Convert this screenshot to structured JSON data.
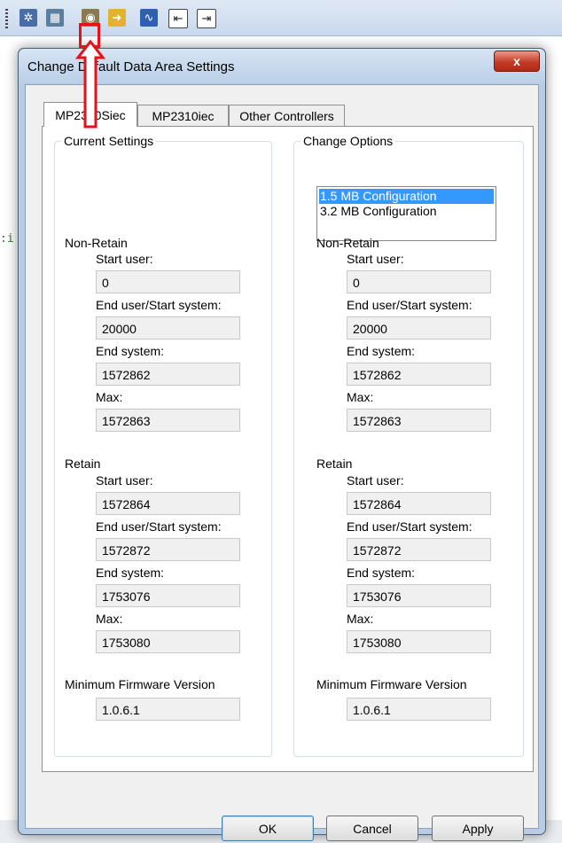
{
  "dialog": {
    "title": "Change Default Data Area Settings",
    "close_symbol": "x"
  },
  "tabs": [
    "MP2300Siec",
    "MP2310iec",
    "Other Controllers"
  ],
  "current": {
    "title": "Current Settings",
    "non_retain": "Non-Retain",
    "retain": "Retain",
    "labels": {
      "start_user": "Start user:",
      "end_user_start_system": "End user/Start system:",
      "end_system": "End system:",
      "max": "Max:",
      "min_fw": "Minimum Firmware Version"
    },
    "values": {
      "nr_start_user": "0",
      "nr_end_user": "20000",
      "nr_end_system": "1572862",
      "nr_max": "1572863",
      "r_start_user": "1572864",
      "r_end_user": "1572872",
      "r_end_system": "1753076",
      "r_max": "1753080",
      "min_fw": "1.0.6.1"
    }
  },
  "options": {
    "title": "Change Options",
    "list": [
      "1.5 MB Configuration",
      "3.2 MB Configuration"
    ],
    "selected_index": 0,
    "non_retain": "Non-Retain",
    "retain": "Retain",
    "labels": {
      "start_user": "Start user:",
      "end_user_start_system": "End user/Start system:",
      "end_system": "End system:",
      "max": "Max:",
      "min_fw": "Minimum Firmware Version"
    },
    "values": {
      "nr_start_user": "0",
      "nr_end_user": "20000",
      "nr_end_system": "1572862",
      "nr_max": "1572863",
      "r_start_user": "1572864",
      "r_end_user": "1572872",
      "r_end_system": "1753076",
      "r_max": "1753080",
      "min_fw": "1.0.6.1"
    }
  },
  "buttons": {
    "ok": "OK",
    "cancel": "Cancel",
    "apply": "Apply"
  },
  "colors": {
    "annotation": "#e8101a",
    "selection": "#3399ff"
  }
}
